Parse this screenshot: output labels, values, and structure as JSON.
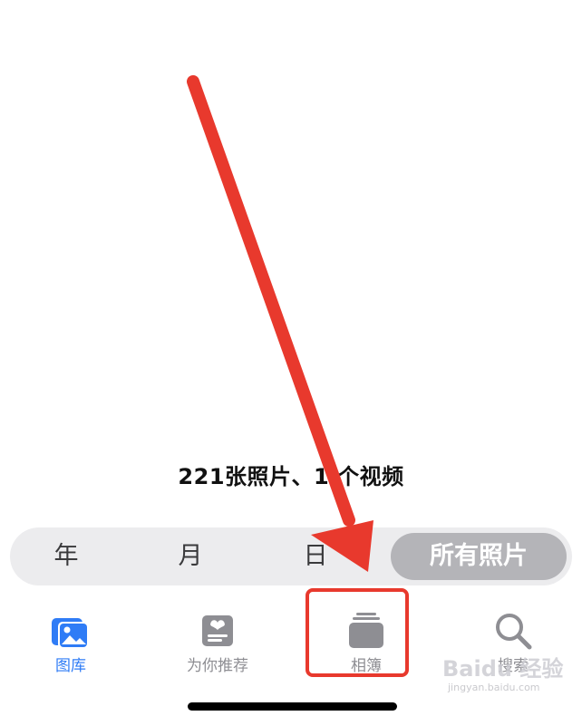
{
  "summary": {
    "text": "221张照片、1 个视频"
  },
  "view_selector": {
    "options": [
      "年",
      "月",
      "日",
      "所有照片"
    ],
    "selected": "所有照片"
  },
  "tab_bar": {
    "tabs": [
      {
        "label": "图库",
        "icon": "library-icon",
        "active": true
      },
      {
        "label": "为你推荐",
        "icon": "for-you-icon",
        "active": false
      },
      {
        "label": "相簿",
        "icon": "albums-icon",
        "active": false
      },
      {
        "label": "搜索",
        "icon": "search-icon",
        "active": false
      }
    ]
  },
  "annotation": {
    "arrow_color": "#e8392d",
    "box_color": "#e8392d"
  },
  "watermark": {
    "logo_text": "Baidu 经验",
    "url": "jingyan.baidu.com"
  },
  "colors": {
    "accent": "#2f7cf6",
    "inactive": "#8e8e93"
  }
}
